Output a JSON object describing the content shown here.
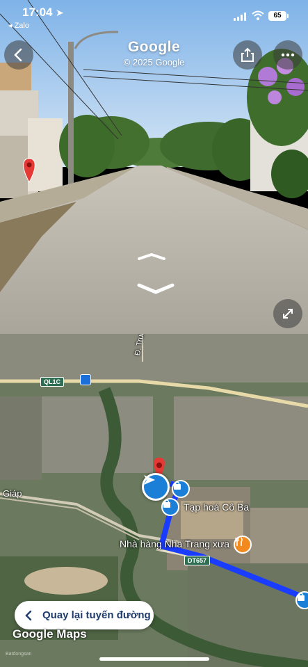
{
  "status_bar": {
    "time": "17:04",
    "back_app": "◂ Zalo",
    "battery": "65"
  },
  "streetview": {
    "brand": "Google",
    "copyright": "© 2025 Google"
  },
  "map": {
    "road_shield": "QL1C",
    "road_shield_2": "DT657",
    "street_label": "Đ. Trung Đ",
    "place_1": "Tạp hoá Cô Ba",
    "place_2": "Nhà hàng Nha Trang xưa",
    "left_label": "Giáp",
    "brand": "Google Maps",
    "watermark": "Batdongsan"
  },
  "back_to_route": {
    "label": "Quay lại tuyến đường"
  },
  "colors": {
    "route_blue": "#1a3cff",
    "location_blue": "#1b7fd8",
    "pin_red": "#e53935",
    "restaurant_orange": "#f28a1f"
  }
}
